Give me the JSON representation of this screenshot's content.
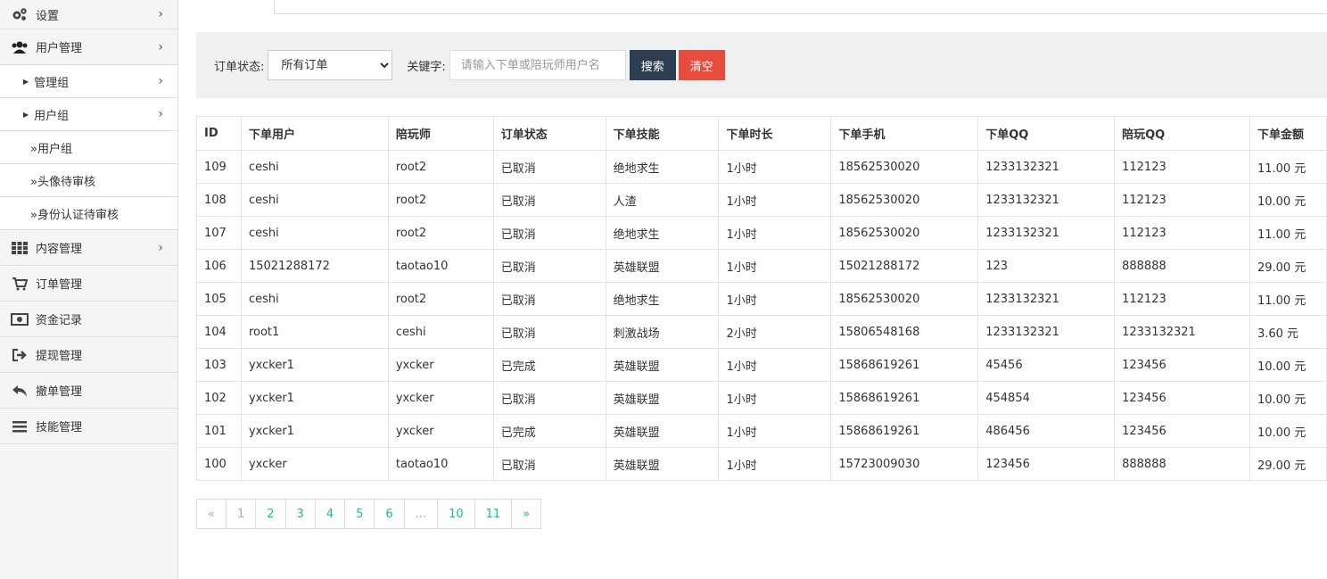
{
  "sidebar": {
    "items": [
      {
        "label": "设置",
        "icon": "gears-icon"
      },
      {
        "label": "用户管理",
        "icon": "users-icon"
      },
      {
        "label": "内容管理",
        "icon": "grid-icon"
      },
      {
        "label": "订单管理",
        "icon": "cart-icon"
      },
      {
        "label": "资金记录",
        "icon": "money-icon"
      },
      {
        "label": "提现管理",
        "icon": "sign-out-icon"
      },
      {
        "label": "撤单管理",
        "icon": "reply-icon"
      },
      {
        "label": "技能管理",
        "icon": "bars-icon"
      }
    ],
    "sub": {
      "admin_group": "管理组",
      "user_group": "用户组",
      "user_group_leaf": "»用户组",
      "avatar_review": "»头像待审核",
      "id_review": "»身份认证待审核"
    }
  },
  "filter": {
    "status_label": "订单状态:",
    "status_value": "所有订单",
    "keyword_label": "关键字:",
    "keyword_placeholder": "请输入下单或陪玩师用户名",
    "search_label": "搜索",
    "clear_label": "清空"
  },
  "table": {
    "headers": [
      "ID",
      "下单用户",
      "陪玩师",
      "订单状态",
      "下单技能",
      "下单时长",
      "下单手机",
      "下单QQ",
      "陪玩QQ",
      "下单金额"
    ],
    "rows": [
      [
        "109",
        "ceshi",
        "root2",
        "已取消",
        "绝地求生",
        "1小时",
        "18562530020",
        "1233132321",
        "112123",
        "11.00 元"
      ],
      [
        "108",
        "ceshi",
        "root2",
        "已取消",
        "人渣",
        "1小时",
        "18562530020",
        "1233132321",
        "112123",
        "10.00 元"
      ],
      [
        "107",
        "ceshi",
        "root2",
        "已取消",
        "绝地求生",
        "1小时",
        "18562530020",
        "1233132321",
        "112123",
        "11.00 元"
      ],
      [
        "106",
        "15021288172",
        "taotao10",
        "已取消",
        "英雄联盟",
        "1小时",
        "15021288172",
        "123",
        "888888",
        "29.00 元"
      ],
      [
        "105",
        "ceshi",
        "root2",
        "已取消",
        "绝地求生",
        "1小时",
        "18562530020",
        "1233132321",
        "112123",
        "11.00 元"
      ],
      [
        "104",
        "root1",
        "ceshi",
        "已取消",
        "刺激战场",
        "2小时",
        "15806548168",
        "1233132321",
        "1233132321",
        "3.60 元"
      ],
      [
        "103",
        "yxcker1",
        "yxcker",
        "已完成",
        "英雄联盟",
        "1小时",
        "15868619261",
        "45456",
        "123456",
        "10.00 元"
      ],
      [
        "102",
        "yxcker1",
        "yxcker",
        "已取消",
        "英雄联盟",
        "1小时",
        "15868619261",
        "454854",
        "123456",
        "10.00 元"
      ],
      [
        "101",
        "yxcker1",
        "yxcker",
        "已完成",
        "英雄联盟",
        "1小时",
        "15868619261",
        "486456",
        "123456",
        "10.00 元"
      ],
      [
        "100",
        "yxcker",
        "taotao10",
        "已取消",
        "英雄联盟",
        "1小时",
        "15723009030",
        "123456",
        "888888",
        "29.00 元"
      ]
    ]
  },
  "pager": [
    "«",
    "1",
    "2",
    "3",
    "4",
    "5",
    "6",
    "...",
    "10",
    "11",
    "»"
  ],
  "colors": {
    "accent": "#18bc9c",
    "search_btn": "#2c3e50",
    "clear_btn": "#e74c3c"
  }
}
